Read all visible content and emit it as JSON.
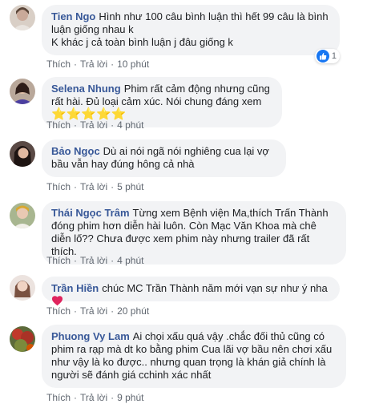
{
  "labels": {
    "like": "Thích",
    "reply": "Trả lời",
    "sep": "·"
  },
  "comments": [
    {
      "name": "Tien Ngo",
      "text": "Hình như 100 câu bình luận thì hết 99 câu là bình luận giống nhau k\nK khác j cả toàn bình luận j đâu giống k",
      "time": "10 phút",
      "reaction_count": "1",
      "avatar_color": "#c9b7a8"
    },
    {
      "name": "Selena Nhung",
      "text": "Phim rất cảm động nhưng cũng rất hài. Đủ loại cảm xúc. Nói chung đáng xem",
      "stars": "⭐⭐⭐⭐⭐",
      "time": "4 phút",
      "avatar_color": "#6b4a3a"
    },
    {
      "name": "Bảo Ngọc",
      "text": "Dù ai nói ngã nói nghiêng cua lại vợ bầu vẫn hay đúng hông cả nhà",
      "time": "5 phút",
      "avatar_color": "#3a2a25"
    },
    {
      "name": "Thái Ngọc Trâm",
      "text": "Từng xem Bệnh viện Ma,thích Trấn Thành đóng phim hơn diễn hài luôn. Còn Mạc Văn Khoa mà chê diễn lố?? Chưa được xem phim này nhưng trailer đã rất thích.",
      "time": "4 phút",
      "avatar_color": "#8a9a6a"
    },
    {
      "name": "Trần Hiền",
      "text": "chúc MC Trần Thành năm mới vạn sự như ý nha",
      "time": "20 phút",
      "avatar_color": "#d8c2b8"
    },
    {
      "name": "Phuong Vy Lam",
      "text": "Ai chọi xấu quá vậy .chắc đối thủ cũng có phim ra rạp mà dt ko bằng phim Cua lãi vợ bầu nên chơi xấu như vậy là ko được.. nhưng quan trọng là khán giả chính là người sẽ đánh giá cchinh xác nhất",
      "time": "9 phút",
      "avatar_color": "#8b3a3a"
    }
  ],
  "colors": {
    "name": "#385898",
    "bubble": "#f2f3f5",
    "meta": "#606770",
    "like_blue": "#1877f2",
    "heart_red": "#e0245e"
  }
}
